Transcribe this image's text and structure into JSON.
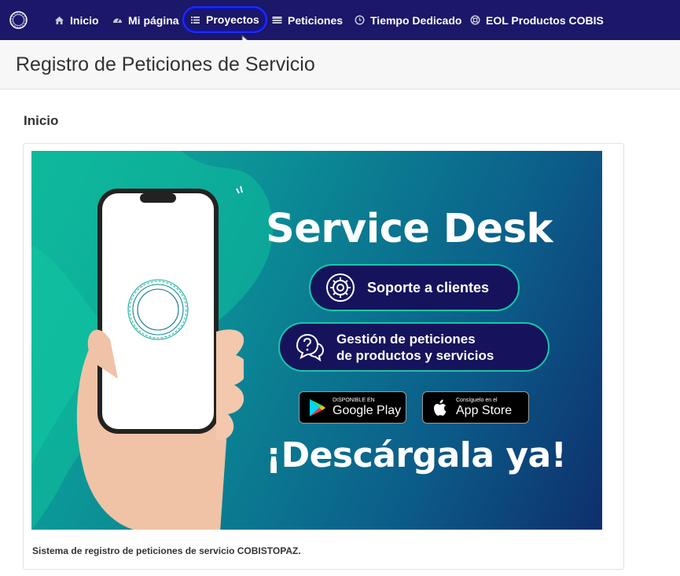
{
  "nav": {
    "items": [
      {
        "label": "Inicio",
        "icon": "home-icon"
      },
      {
        "label": "Mi página",
        "icon": "dashboard-icon"
      },
      {
        "label": "Proyectos",
        "icon": "list-icon"
      },
      {
        "label": "Peticiones",
        "icon": "tasks-icon"
      },
      {
        "label": "Tiempo Dedicado",
        "icon": "clock-icon"
      },
      {
        "label": "EOL Productos COBIS",
        "icon": "lifebuoy-icon"
      }
    ],
    "active": "Proyectos",
    "colors": {
      "background": "#1b1769",
      "active_outline": "#1f2cff"
    }
  },
  "header": {
    "title": "Registro de Peticiones de Servicio"
  },
  "main": {
    "section_title": "Inicio",
    "banner": {
      "title": "Service Desk",
      "pill_support": "Soporte a clientes",
      "pill_management_line1": "Gestión de peticiones",
      "pill_management_line2": "de productos y servicios",
      "google_small": "DISPONIBLE EN",
      "google_big": "Google Play",
      "apple_small": "Consíguelo en el",
      "apple_big": "App Store",
      "cta": "¡Descárgala ya!",
      "colors": {
        "teal": "#0fb39a",
        "navy": "#16135d",
        "accent": "#17c7a8"
      }
    },
    "caption": "Sistema de registro de peticiones de servicio COBISTOPAZ."
  }
}
